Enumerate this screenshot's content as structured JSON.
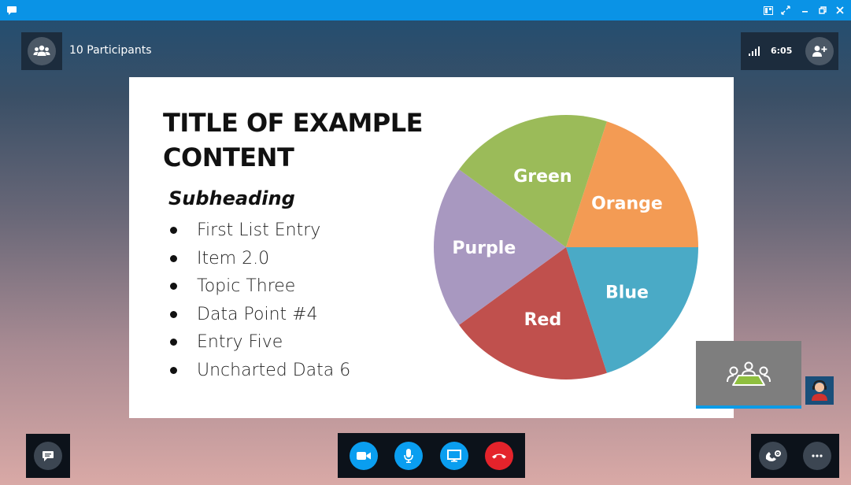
{
  "participants": {
    "label": "10 Participants"
  },
  "call": {
    "timer": "6:05"
  },
  "slide": {
    "title": "TITLE OF EXAMPLE CONTENT",
    "subheading": "Subheading",
    "list": [
      "First List Entry",
      "Item 2.0",
      "Topic Three",
      "Data Point #4",
      "Entry Five",
      "Uncharted Data 6"
    ]
  },
  "chart_data": {
    "type": "pie",
    "slices": [
      {
        "label": "Orange",
        "value": 20,
        "color": "#f39b54"
      },
      {
        "label": "Blue",
        "value": 20,
        "color": "#4aaac6"
      },
      {
        "label": "Red",
        "value": 20,
        "color": "#c0504d"
      },
      {
        "label": "Purple",
        "value": 20,
        "color": "#a898c0"
      },
      {
        "label": "Green",
        "value": 20,
        "color": "#9bbb59"
      }
    ]
  },
  "icons": {
    "app": "skype-chat-icon",
    "participants": "people-icon",
    "signal": "signal-bars-icon",
    "add_person": "add-person-icon",
    "chat": "chat-bubble-icon",
    "video": "video-camera-icon",
    "mic": "microphone-icon",
    "share": "monitor-icon",
    "hangup": "phone-hangup-icon",
    "dialpad": "phone-settings-icon",
    "more": "more-icon"
  },
  "colors": {
    "titlebar": "#0a93e6",
    "accent": "#0a9ef0",
    "hangup": "#e4232b"
  }
}
